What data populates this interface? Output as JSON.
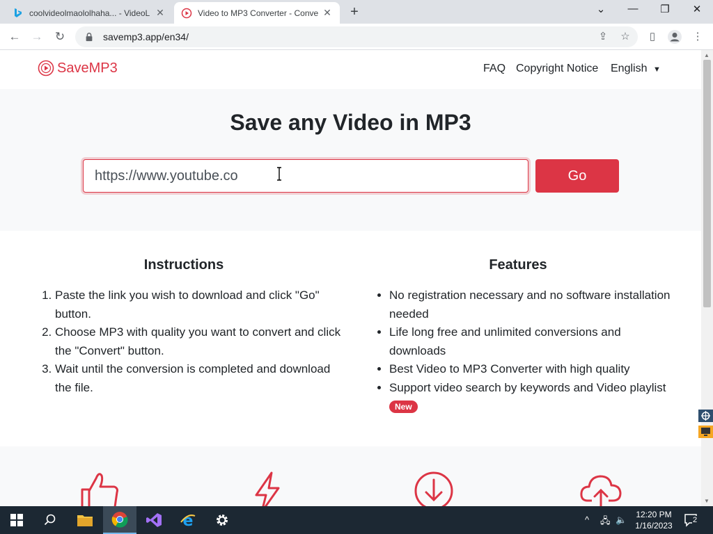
{
  "browser": {
    "tabs": [
      {
        "title": "coolvideolmaololhaha... - VideoL"
      },
      {
        "title": "Video to MP3 Converter - Conve"
      }
    ],
    "address": "savemp3.app/en34/"
  },
  "site": {
    "logo_text": "SaveMP3",
    "nav": {
      "faq": "FAQ",
      "copyright": "Copyright Notice",
      "language": "English"
    },
    "hero": {
      "title": "Save any Video in MP3",
      "input_value": "https://www.youtube.co",
      "go_label": "Go"
    },
    "instructions": {
      "title": "Instructions",
      "items": [
        "Paste the link you wish to download and click \"Go\" button.",
        "Choose MP3 with quality you want to convert and click the \"Convert\" button.",
        "Wait until the conversion is completed and download the file."
      ]
    },
    "features": {
      "title": "Features",
      "items": [
        "No registration necessary and no software installation needed",
        "Life long free and unlimited conversions and downloads",
        "Best Video to MP3 Converter with high quality",
        "Support video search by keywords and Video playlist"
      ],
      "badge": "New"
    },
    "feature_icons": [
      "thumbs-up-icon",
      "lightning-icon",
      "download-circle-icon",
      "cloud-upload-icon"
    ]
  },
  "taskbar": {
    "time": "12:20 PM",
    "date": "1/16/2023",
    "notifications": "2"
  },
  "colors": {
    "accent": "#dc3545",
    "hero_bg": "#f8f9fa",
    "taskbar": "#1c2833"
  }
}
